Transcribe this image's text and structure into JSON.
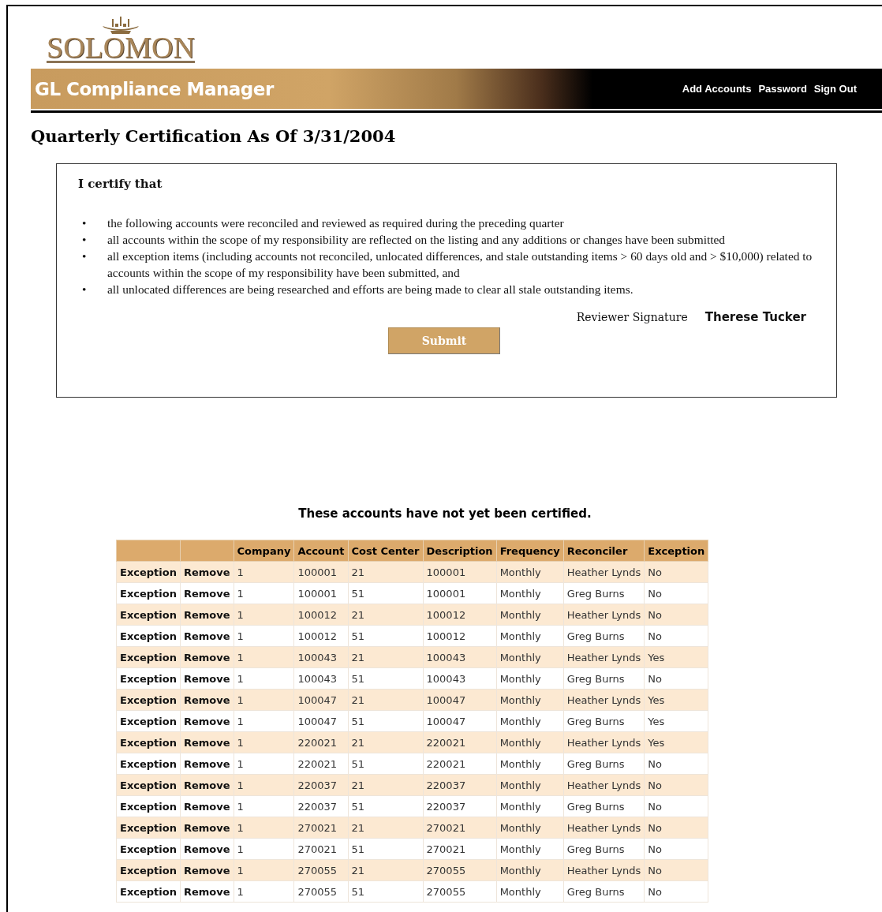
{
  "logo": {
    "text": "SOLOMON"
  },
  "banner": {
    "title": "GL Compliance Manager",
    "links": [
      "Add Accounts",
      "Password",
      "Sign Out"
    ]
  },
  "page_title": "Quarterly Certification As Of 3/31/2004",
  "certification": {
    "heading": "I certify that",
    "items": [
      {
        "bullet": "•",
        "text": "the following accounts were reconciled and reviewed as required during the preceding quarter"
      },
      {
        "bullet": "•",
        "text": "all accounts within the scope of my responsibility are reflected on the listing and any additions or changes have been submitted"
      },
      {
        "bullet": "•",
        "text": "all exception items (including accounts not reconciled, unlocated differences, and stale outstanding items > 60 days old and > $10,000) related to accounts within the scope of my responsibility have been submitted, and"
      },
      {
        "bullet": "•",
        "text": "all unlocated differences are being researched and efforts are being made to clear all stale outstanding items."
      }
    ],
    "signature_label": "Reviewer Signature",
    "signature_name": "Therese Tucker",
    "submit": "Submit"
  },
  "table": {
    "caption": "These accounts have not yet been certified.",
    "columns": [
      "Company",
      "Account",
      "Cost Center",
      "Description",
      "Frequency",
      "Reconciler",
      "Exception"
    ],
    "rows": [
      {
        "exception_link": "Exception",
        "remove_link": "Remove",
        "cells": [
          "1",
          "100001",
          "21",
          "100001",
          "Monthly",
          "Heather Lynds",
          "No"
        ]
      },
      {
        "exception_link": "Exception",
        "remove_link": "Remove",
        "cells": [
          "1",
          "100001",
          "51",
          "100001",
          "Monthly",
          "Greg Burns",
          "No"
        ]
      },
      {
        "exception_link": "Exception",
        "remove_link": "Remove",
        "cells": [
          "1",
          "100012",
          "21",
          "100012",
          "Monthly",
          "Heather Lynds",
          "No"
        ]
      },
      {
        "exception_link": "Exception",
        "remove_link": "Remove",
        "cells": [
          "1",
          "100012",
          "51",
          "100012",
          "Monthly",
          "Greg Burns",
          "No"
        ]
      },
      {
        "exception_link": "Exception",
        "remove_link": "Remove",
        "cells": [
          "1",
          "100043",
          "21",
          "100043",
          "Monthly",
          "Heather Lynds",
          "Yes"
        ]
      },
      {
        "exception_link": "Exception",
        "remove_link": "Remove",
        "cells": [
          "1",
          "100043",
          "51",
          "100043",
          "Monthly",
          "Greg Burns",
          "No"
        ]
      },
      {
        "exception_link": "Exception",
        "remove_link": "Remove",
        "cells": [
          "1",
          "100047",
          "21",
          "100047",
          "Monthly",
          "Heather Lynds",
          "Yes"
        ]
      },
      {
        "exception_link": "Exception",
        "remove_link": "Remove",
        "cells": [
          "1",
          "100047",
          "51",
          "100047",
          "Monthly",
          "Greg Burns",
          "Yes"
        ]
      },
      {
        "exception_link": "Exception",
        "remove_link": "Remove",
        "cells": [
          "1",
          "220021",
          "21",
          "220021",
          "Monthly",
          "Heather Lynds",
          "Yes"
        ]
      },
      {
        "exception_link": "Exception",
        "remove_link": "Remove",
        "cells": [
          "1",
          "220021",
          "51",
          "220021",
          "Monthly",
          "Greg Burns",
          "No"
        ]
      },
      {
        "exception_link": "Exception",
        "remove_link": "Remove",
        "cells": [
          "1",
          "220037",
          "21",
          "220037",
          "Monthly",
          "Heather Lynds",
          "No"
        ]
      },
      {
        "exception_link": "Exception",
        "remove_link": "Remove",
        "cells": [
          "1",
          "220037",
          "51",
          "220037",
          "Monthly",
          "Greg Burns",
          "No"
        ]
      },
      {
        "exception_link": "Exception",
        "remove_link": "Remove",
        "cells": [
          "1",
          "270021",
          "21",
          "270021",
          "Monthly",
          "Heather Lynds",
          "No"
        ]
      },
      {
        "exception_link": "Exception",
        "remove_link": "Remove",
        "cells": [
          "1",
          "270021",
          "51",
          "270021",
          "Monthly",
          "Greg Burns",
          "No"
        ]
      },
      {
        "exception_link": "Exception",
        "remove_link": "Remove",
        "cells": [
          "1",
          "270055",
          "21",
          "270055",
          "Monthly",
          "Heather Lynds",
          "No"
        ]
      },
      {
        "exception_link": "Exception",
        "remove_link": "Remove",
        "cells": [
          "1",
          "270055",
          "51",
          "270055",
          "Monthly",
          "Greg Burns",
          "No"
        ]
      }
    ]
  }
}
